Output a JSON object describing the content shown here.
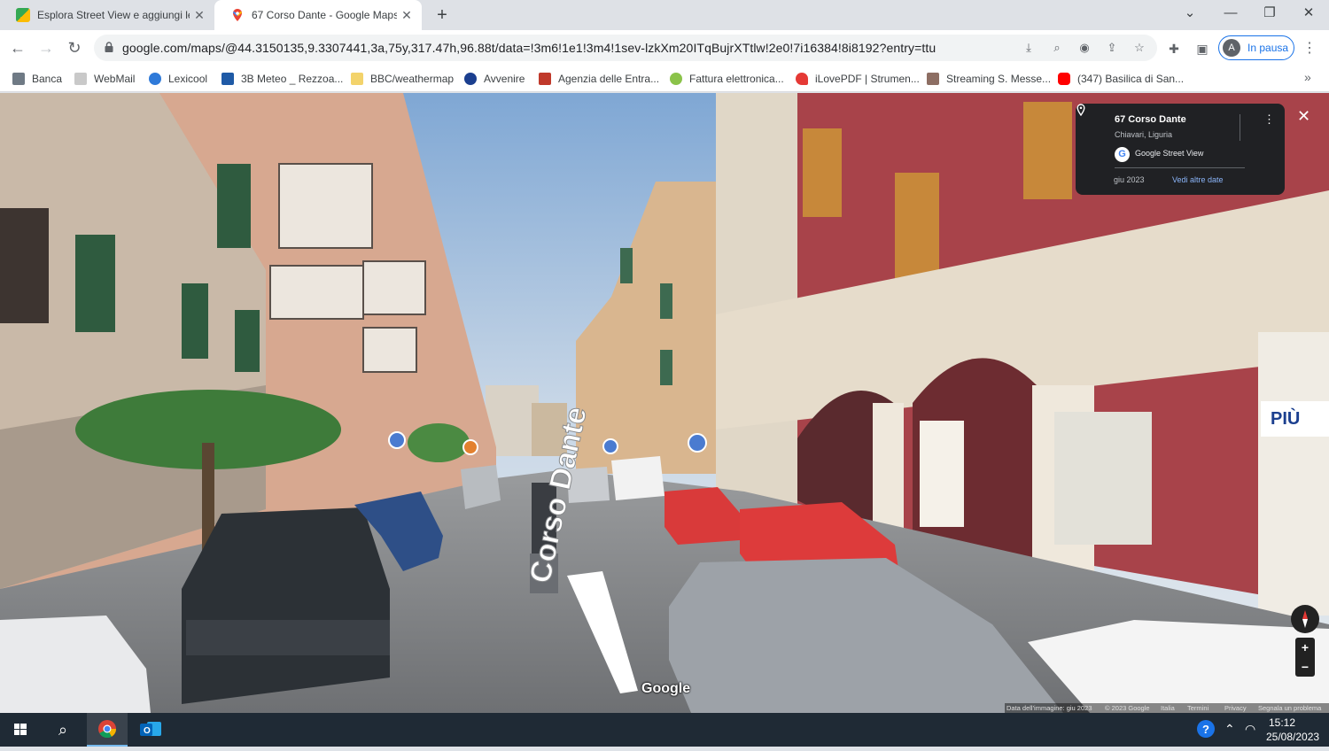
{
  "tabs": [
    {
      "title": "Esplora Street View e aggiungi le",
      "active": false
    },
    {
      "title": "67 Corso Dante - Google Maps",
      "active": true
    }
  ],
  "toolbar": {
    "url": "google.com/maps/@44.3150135,9.3307441,3a,75y,317.47h,96.88t/data=!3m6!1e1!3m4!1sev-lzkXm20ITqBujrXTtlw!2e0!7i16384!8i8192?entry=ttu",
    "profile_initial": "A",
    "profile_label": "In pausa"
  },
  "bookmarks": [
    {
      "label": "Banca",
      "color": "#6f7a85"
    },
    {
      "label": "WebMail",
      "color": "#c9c9c9"
    },
    {
      "label": "Lexicool",
      "color": "#2f7ad9"
    },
    {
      "label": "3B Meteo _ Rezzoa...",
      "color": "#1f5aa6"
    },
    {
      "label": "BBC/weathermap",
      "color": "#f3d36b"
    },
    {
      "label": "Avvenire",
      "color": "#1b3f8f"
    },
    {
      "label": "Agenzia delle Entra...",
      "color": "#c0392b"
    },
    {
      "label": "Fattura elettronica...",
      "color": "#8bc34a"
    },
    {
      "label": "iLovePDF | Strumen...",
      "color": "#e53935"
    },
    {
      "label": "Streaming S. Messe...",
      "color": "#8d6e63"
    },
    {
      "label": "(347) Basilica di San...",
      "color": "#ff0000"
    }
  ],
  "streetview": {
    "place_title": "67 Corso Dante",
    "place_sub": "Chiavari, Liguria",
    "source": "Google Street View",
    "date": "giu 2023",
    "more_dates": "Vedi altre date",
    "street_label": "Corso Dante",
    "logo": "Google",
    "footer": [
      "Data dell'immagine: giu 2023",
      "© 2023 Google",
      "Italia",
      "Termini",
      "Privacy",
      "Segnala un problema"
    ],
    "zoom_in": "+",
    "zoom_out": "−"
  },
  "taskbar": {
    "time": "15:12",
    "date": "25/08/2023"
  }
}
